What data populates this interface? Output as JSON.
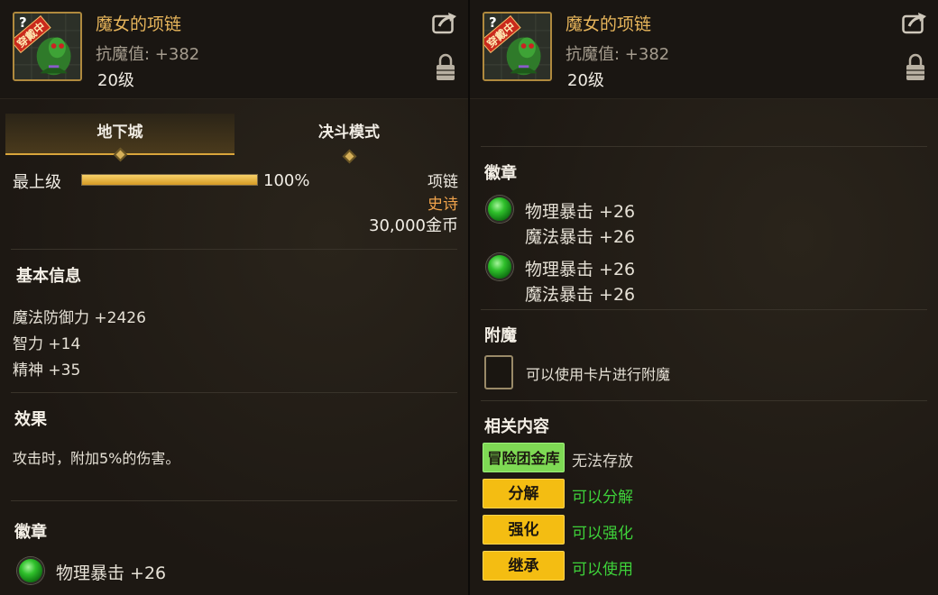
{
  "item": {
    "name": "魔女的项链",
    "sub_stat": "抗魔值: +382",
    "level": "20级",
    "equip_badge": "穿戴中",
    "help_mark": "?",
    "type": "项链",
    "rarity": "史诗",
    "price": "30,000金币"
  },
  "tabs": [
    {
      "label": "地下城",
      "active": true
    },
    {
      "label": "决斗模式",
      "active": false
    }
  ],
  "tier": {
    "label": "最上级",
    "percent_text": "100%",
    "fill_fraction": 1.0
  },
  "basic_info": {
    "title": "基本信息",
    "stats": [
      "魔法防御力 +2426",
      "智力 +14",
      "精神 +35"
    ]
  },
  "effect": {
    "title": "效果",
    "text": "攻击时，附加5%的伤害。"
  },
  "left_emblem": {
    "title": "徽章",
    "line": "物理暴击 +26"
  },
  "right_emblems": {
    "title": "徽章",
    "gems": [
      {
        "line1": "物理暴击 +26",
        "line2": "魔法暴击 +26"
      },
      {
        "line1": "物理暴击 +26",
        "line2": "魔法暴击 +26"
      }
    ]
  },
  "enchant": {
    "title": "附魔",
    "text": "可以使用卡片进行附魔"
  },
  "related": {
    "title": "相关内容",
    "rows": [
      {
        "button": "冒险团金库",
        "note": "无法存放",
        "button_color": "#7ed954",
        "note_color": "#d8d3c9"
      },
      {
        "button": "分解",
        "note": "可以分解",
        "button_color": "#f4bd12",
        "note_color": "#3ed23a"
      },
      {
        "button": "强化",
        "note": "可以强化",
        "button_color": "#f4bd12",
        "note_color": "#3ed23a"
      },
      {
        "button": "继承",
        "note": "可以使用",
        "button_color": "#f4bd12",
        "note_color": "#3ed23a"
      }
    ]
  },
  "colors": {
    "accent_gold": "#e7b55b",
    "epic_orange": "#f0a34b",
    "gem_green": "#2fc02b"
  }
}
